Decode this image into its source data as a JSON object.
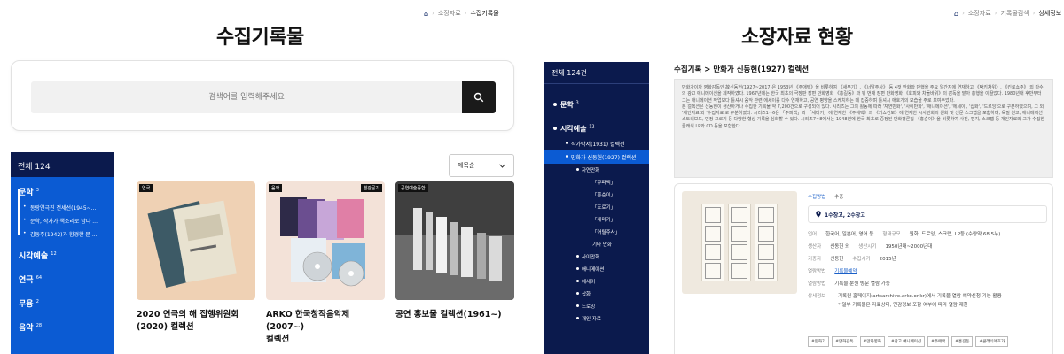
{
  "left": {
    "breadcrumb": [
      "소장자료",
      "수집기록물"
    ],
    "title": "수집기록물",
    "search": {
      "placeholder": "검색어를 입력해주세요"
    },
    "sidebar": {
      "header": "전체 124",
      "items": [
        {
          "label": "문학",
          "count": "3"
        },
        {
          "label": "시각예술",
          "count": "12"
        },
        {
          "label": "연극",
          "count": "64"
        },
        {
          "label": "무용",
          "count": "2"
        },
        {
          "label": "음악",
          "count": "28"
        }
      ],
      "sub_items": [
        "동랑연극진 전세선(1945~...",
        "문학, 작가가 책소리로 남다 ...",
        "김동주(1942)가 함경한 문 ..."
      ]
    },
    "sort": {
      "label": "제목순"
    },
    "cards": [
      {
        "tag": "연극",
        "tag_right": "",
        "title_line1": "2020 연극의 해 집행위원회",
        "title_line2": "(2020) 컬렉션"
      },
      {
        "tag": "음악",
        "tag_right": "별관문기",
        "title_line1": "ARKO 한국창작음악제(2007~)",
        "title_line2": "컬렉션"
      },
      {
        "tag": "공연예술종합",
        "tag_right": "",
        "title_line1": "공연 홍보물 컬렉션(1961~)",
        "title_line2": ""
      }
    ]
  },
  "right": {
    "breadcrumb": [
      "소장자료",
      "기록물검색",
      "상세정보"
    ],
    "title": "소장자료 현황",
    "sidebar": {
      "header": "전체 124건",
      "items": [
        {
          "label": "문학",
          "count": "3"
        },
        {
          "label": "시각예술",
          "count": "12"
        }
      ],
      "sub_items": [
        "작가박서(1931) 컬렉션",
        "만화가 신동헌(1927) 컬렉션"
      ],
      "sub2_items": [
        "자연만화",
        "사이만화",
        "애니메이션",
        "에세이",
        "삽화",
        "드로잉",
        "개인 자료"
      ],
      "sub3_items": [
        "「주파백」",
        "「홍순이」",
        "「도로기」",
        "「새마기」",
        "「어릴주사」",
        "기타 만화"
      ]
    },
    "detail": {
      "title": "수집기록 > 만화가 신동헌(1927) 컬렉션",
      "desc_p1": "만화가이자 영화감독인 故신동헌(1927~2017)은 1953년 《주애택》을 비롯하여 《새부기》, 《너탈주사》 등 4컷 만화와 단행을 주요 일간지에 연재하고 《탁키차위》, 《킨로쇼주》 외 다수의 광고 애니메이션을 제작하였다. 1967년에는 한국 최초의 극장판 장편 만화영화 《홍길동》과 뒤 번째 장편 만화영화 《호피와 차돌바위》의 감독을 맡아 흥행을 이끌었다. 1980년대 후반부터 그는 애니메이션 작업보다 틀셔시 음악 관련 에세이를 다수 연재하고, 공연 평양을 스케치하는 데 집중하며 틀셔시 애호가의 모습을 주로 보여주었다.",
      "desc_p2": "본 컬렉션은 신동헌이 생산하거나 수집한 기록물 약 7,200건으로 구성되어 있다. 시리즈는 그의 활동에 따라 '자연만화', '사이만화', '애니메이션', '에세이', '삽화', '드로잉'으로 구분하였으며, 그 외 '개인자료'와 '수집자료'로 구분하였다. 시리즈1~6은 「주파백」과 「새마기」에 연재한 《주애택》과 《키쇼킨보》에 연재한 시사만화의 원화 및 신문 스크랩을 포함하며, 육필 원고, 애니메이션 스토리보드, 민정 그로기 등 다양한 형상 기록을 심화할 수 있다. 시리즈7~8에서는 1948년에 한국 최초로 증정된 만화평론집 《홍순이》을 비롯하여 사진, 편지, 스크랩 등 개인자료와 그가 수집한 클래식 LP와 CD 등을 포함한다.",
      "method_label": "수집방법",
      "method_value": "수증",
      "location": "1수장고, 2수장고",
      "lang_label": "언어",
      "lang_value": "한국어, 일본어, 영어 등",
      "size_label": "형태규모",
      "size_value": "원화, 드로잉, 스크랩, LP등 (수량약 68.5누)",
      "creator_label": "생산자",
      "creator_value": "신동헌 외",
      "period_label": "생산시기",
      "period_value": "1950년대~2000년대",
      "donor_label": "기증자",
      "donor_value": "신동헌",
      "year_label": "수집시기",
      "year_value": "2015년",
      "view_label": "열람방법",
      "view_value": "기록물예약",
      "view2_label": "열람방법",
      "view2_value": "기록물 분원 방문 열람 가능",
      "note_label": "상세정보",
      "note_value": "- 기록원 홈페이지(artsarchive.arko.or.kr)에서 기록물 열람 예약신청 기능 활용",
      "note_value2": "* 일부 기록물은 자료상태, 민감정보 포함 여부에 따라 열람 제한",
      "chips": [
        "#만화가",
        "#만화감독",
        "#만화영화",
        "#광고 애니메이션",
        "#주애택",
        "#홍길동",
        "#클래식애호가"
      ]
    }
  }
}
